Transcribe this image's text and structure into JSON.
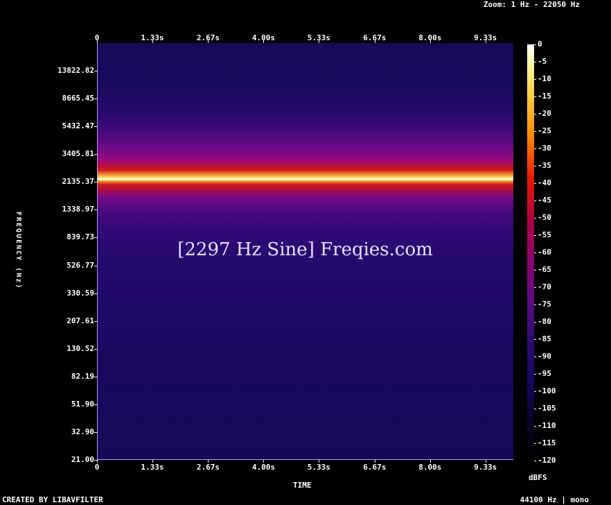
{
  "header": {
    "zoom_text": "Zoom: 1 Hz - 22050 Hz"
  },
  "footer": {
    "credit": "CREATED BY LIBAVFILTER",
    "info": "44100 Hz | mono"
  },
  "watermark": "[2297 Hz Sine] Freqies.com",
  "chart_data": {
    "type": "heatmap",
    "title": "",
    "xlabel": "TIME",
    "ylabel": "FREQUENCY (Hz)",
    "x_ticks": [
      "0",
      "1.33s",
      "2.67s",
      "4.00s",
      "5.33s",
      "6.67s",
      "8.00s",
      "9.33s"
    ],
    "x_values": [
      0,
      1.33,
      2.67,
      4.0,
      5.33,
      6.67,
      8.0,
      9.33
    ],
    "xlim": [
      0,
      10
    ],
    "y_ticks": [
      "13822.82",
      "8665.45",
      "5432.47",
      "3405.81",
      "2135.37",
      "1338.97",
      "839.73",
      "526.77",
      "330.59",
      "207.61",
      "130.52",
      "82.19",
      "51.90",
      "32.90",
      "21.00"
    ],
    "y_scale": "log",
    "ylim": [
      21,
      22050
    ],
    "tone_frequency_hz": 2297,
    "colorbar": {
      "label": "dBFS",
      "ticks": [
        "0",
        "-5",
        "-10",
        "-15",
        "-20",
        "-25",
        "-30",
        "-35",
        "-40",
        "-45",
        "-50",
        "-55",
        "-60",
        "-65",
        "-70",
        "-75",
        "-80",
        "-85",
        "-90",
        "-95",
        "-100",
        "-105",
        "-110",
        "-115",
        "-120"
      ],
      "range": [
        -120,
        0
      ]
    }
  }
}
